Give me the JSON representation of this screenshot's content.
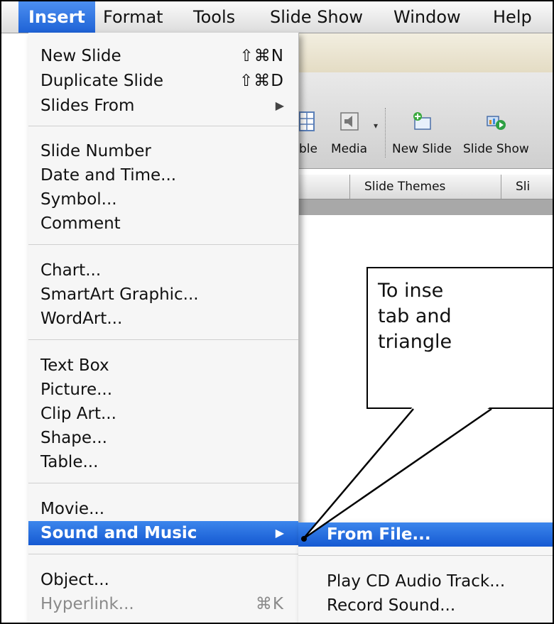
{
  "menubar": {
    "items": [
      {
        "label": "Insert",
        "active": true
      },
      {
        "label": "Format"
      },
      {
        "label": "Tools"
      },
      {
        "label": "Slide Show"
      },
      {
        "label": "Window"
      },
      {
        "label": "Help"
      }
    ]
  },
  "toolbar": {
    "table_partial": "ble",
    "media": "Media",
    "new_slide": "New Slide",
    "slide_show": "Slide Show"
  },
  "tabs": {
    "slide_themes": "Slide Themes",
    "partial": "Sli"
  },
  "insert_menu": {
    "new_slide": {
      "label": "New Slide",
      "shortcut": "⇧⌘N"
    },
    "duplicate_slide": {
      "label": "Duplicate Slide",
      "shortcut": "⇧⌘D"
    },
    "slides_from": {
      "label": "Slides From"
    },
    "slide_number": {
      "label": "Slide Number"
    },
    "date_and_time": {
      "label": "Date and Time..."
    },
    "symbol": {
      "label": "Symbol..."
    },
    "comment": {
      "label": "Comment"
    },
    "chart": {
      "label": "Chart..."
    },
    "smartart": {
      "label": "SmartArt Graphic..."
    },
    "wordart": {
      "label": "WordArt..."
    },
    "text_box": {
      "label": "Text Box"
    },
    "picture": {
      "label": "Picture..."
    },
    "clip_art": {
      "label": "Clip Art..."
    },
    "shape": {
      "label": "Shape..."
    },
    "table": {
      "label": "Table..."
    },
    "movie": {
      "label": "Movie..."
    },
    "sound_and_music": {
      "label": "Sound and Music",
      "highlighted": true
    },
    "object": {
      "label": "Object..."
    },
    "hyperlink": {
      "label": "Hyperlink...",
      "shortcut": "⌘K",
      "disabled": true
    }
  },
  "submenu": {
    "from_file": {
      "label": "From File...",
      "highlighted": true
    },
    "play_cd": {
      "label": "Play CD Audio Track..."
    },
    "record_sound": {
      "label": "Record Sound..."
    }
  },
  "callout": {
    "line1": "To inse",
    "line2": "tab and",
    "line3": "triangle"
  },
  "colors": {
    "highlight": "#1e62d6",
    "menu_bg": "#f6f6f6"
  }
}
